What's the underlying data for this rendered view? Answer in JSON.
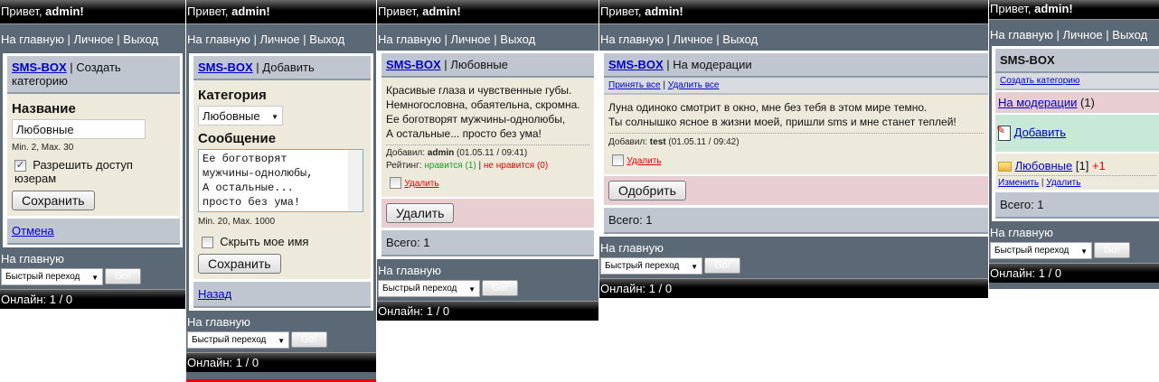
{
  "common": {
    "greeting": "Привет, ",
    "user": "admin!",
    "nav_home": "На главную",
    "nav_personal": "Личное",
    "nav_exit": "Выход",
    "sep": " | ",
    "footer_home": "На главную",
    "quick_jump": "Быстрый переход",
    "go": "Go!",
    "online": "Онлайн: 1 / 0",
    "brand": "SMS-BOX"
  },
  "p1": {
    "title": "Создать категорию",
    "name_label": "Название",
    "name_value": "Любовные",
    "hint": "Min. 2, Max. 30",
    "allow_label": "Разрешить доступ юзерам",
    "save": "Сохранить",
    "cancel": "Отмена"
  },
  "p2": {
    "title": "Добавить",
    "cat_label": "Категория",
    "cat_value": "Любовные",
    "msg_label": "Сообщение",
    "msg_lines": [
      "Ее боготворят",
      "мужчины-однолюбы,",
      "А остальные...",
      "просто без ума!"
    ],
    "hint": "Min. 20, Max. 1000",
    "hide_label": "Скрыть мое имя",
    "save": "Сохранить",
    "back": "Назад"
  },
  "p3": {
    "title": "Любовные",
    "lines": [
      "Красивые глаза и чувственные губы.",
      "Немногословна, обаятельна, скромна.",
      "Ее боготворят мужчины-однолюбы,",
      "А остальные... просто без ума!"
    ],
    "added_label": "Добавил: ",
    "author": "admin",
    "date": " (01.05.11 / 09:41)",
    "rating_label": "Рейтинг: ",
    "like": "нравится (1)",
    "dislike": "не нравится (0)",
    "delete_link": "Удалить",
    "delete_btn": "Удалить",
    "total": "Всего: 1"
  },
  "p4": {
    "title": "На модерации",
    "accept_all": "Принять все",
    "delete_all": "Удалить все",
    "lines": [
      "Луна одиноко смотрит в окно, мне без тебя в этом мире темно.",
      "Ты солнышко ясное в жизни моей, пришли sms и мне станет теплей!"
    ],
    "added_label": "Добавил: ",
    "author": "test",
    "date": " (01.05.11 / 09:42)",
    "delete_link": "Удалить",
    "approve": "Одобрить",
    "total": "Всего: 1"
  },
  "p5": {
    "create_cat": "Создать категорию",
    "moderation": "На модерации",
    "moderation_count": " (1)",
    "add": "Добавить",
    "category": "Любовные",
    "cat_count": " [1] ",
    "cat_new": "+1",
    "edit": "Изменить",
    "delete": "Удалить",
    "total": "Всего: 1"
  }
}
